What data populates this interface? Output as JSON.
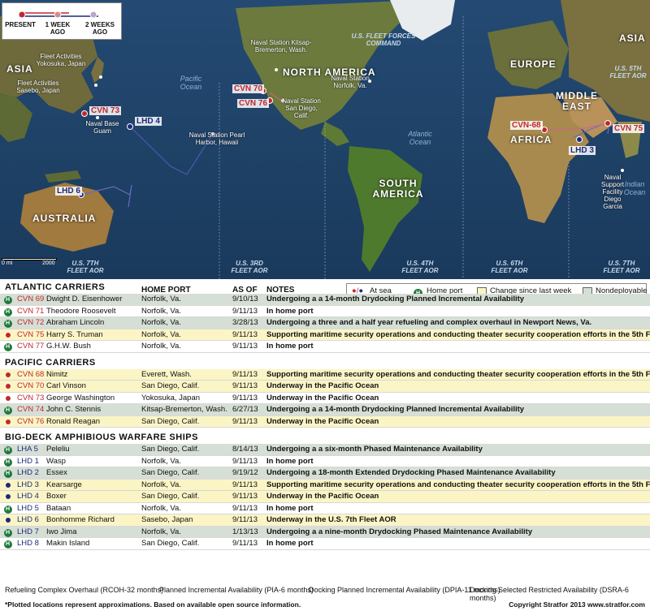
{
  "map": {
    "key": {
      "present": "PRESENT",
      "week_ago": "1 WEEK AGO",
      "two_weeks_ago": "2 WEEKS AGO"
    },
    "continents": [
      "ASIA",
      "NORTH AMERICA",
      "EUROPE",
      "MIDDLE EAST",
      "AFRICA",
      "SOUTH AMERICA",
      "AUSTRALIA",
      "ASIA"
    ],
    "oceans": [
      "Pacific Ocean",
      "Atlantic Ocean",
      "Indian Ocean"
    ],
    "fleets": [
      "U.S. FLEET FORCES COMMAND",
      "U.S. 5TH FLEET AOR",
      "U.S. 7TH FLEET AOR",
      "U.S. 3RD FLEET AOR",
      "U.S. 4TH FLEET AOR",
      "U.S. 6TH FLEET AOR",
      "U.S. 7TH FLEET AOR"
    ],
    "bases": [
      "Fleet Activities Yokosuka, Japan",
      "Fleet Activities Sasebo, Japan",
      "Naval Base Guam",
      "Naval Station Pearl Harbor, Hawaii",
      "Naval Station Kitsap-Bremerton, Wash.",
      "Naval Station San Diego, Calif.",
      "Naval Station Norfolk, Va.",
      "Naval Support Facility Diego Garcia"
    ],
    "ships": [
      "CVN 73",
      "LHD 4",
      "CVN 70",
      "CVN 76",
      "LHD 6",
      "CVN-68",
      "CVN 75",
      "LHD 3"
    ],
    "scale": {
      "zero": "0 mi",
      "max": "2000"
    }
  },
  "legend": {
    "at_sea": "At sea",
    "home_port": "Home port",
    "change": "Change since last week",
    "nondeployable": "Nondeployable"
  },
  "headers": {
    "home_port": "HOME PORT",
    "as_of": "AS OF",
    "notes": "NOTES"
  },
  "sections": [
    {
      "title": "ATLANTIC CARRIERS",
      "rows": [
        {
          "status": "home",
          "hull": "CVN 69",
          "name": "Dwight D. Eisenhower",
          "port": "Norfolk, Va.",
          "date": "9/10/13",
          "note": "Undergoing a a 14-month Drydocking Planned Incremental Availability",
          "shade": "nd"
        },
        {
          "status": "home",
          "hull": "CVN 71",
          "name": "Theodore Roosevelt",
          "port": "Norfolk, Va.",
          "date": "9/11/13",
          "note": "In home port",
          "shade": ""
        },
        {
          "status": "home",
          "hull": "CVN 72",
          "name": "Abraham Lincoln",
          "port": "Norfolk, Va.",
          "date": "3/28/13",
          "note": "Undergoing a three and a half year refueling and complex overhaul in Newport News, Va.",
          "shade": "nd"
        },
        {
          "status": "sea",
          "hull": "CVN 75",
          "name": "Harry S. Truman",
          "port": "Norfolk, Va.",
          "date": "9/11/13",
          "note": "Supporting maritime security operations and conducting theater security cooperation efforts in the 5th Fleet AOR",
          "shade": "hl"
        },
        {
          "status": "home",
          "hull": "CVN 77",
          "name": "G.H.W. Bush",
          "port": "Norfolk, Va.",
          "date": "9/11/13",
          "note": "In home port",
          "shade": ""
        }
      ]
    },
    {
      "title": "PACIFIC CARRIERS",
      "rows": [
        {
          "status": "sea",
          "hull": "CVN 68",
          "name": "Nimitz",
          "port": "Everett, Wash.",
          "date": "9/11/13",
          "note": "Supporting maritime security operations and conducting theater security cooperation efforts in the 5th Fleet AOR",
          "shade": "hl"
        },
        {
          "status": "sea",
          "hull": "CVN 70",
          "name": "Carl Vinson",
          "port": "San Diego, Calif.",
          "date": "9/11/13",
          "note": "Underway in the Pacific Ocean",
          "shade": "hl"
        },
        {
          "status": "sea",
          "hull": "CVN 73",
          "name": "George Washington",
          "port": "Yokosuka, Japan",
          "date": "9/11/13",
          "note": "Underway in the Pacific Ocean",
          "shade": ""
        },
        {
          "status": "home",
          "hull": "CVN 74",
          "name": "John C. Stennis",
          "port": "Kitsap-Bremerton, Wash.",
          "date": "6/27/13",
          "note": "Undergoing a a 14-month Drydocking Planned Incremental Availability",
          "shade": "nd"
        },
        {
          "status": "sea",
          "hull": "CVN 76",
          "name": "Ronald Reagan",
          "port": "San Diego, Calif.",
          "date": "9/11/13",
          "note": "Underway in the Pacific Ocean",
          "shade": "hl"
        }
      ]
    },
    {
      "title": "BIG-DECK AMPHIBIOUS WARFARE SHIPS",
      "rows": [
        {
          "status": "home",
          "hull": "LHA 5",
          "name": "Peleliu",
          "port": "San Diego, Calif.",
          "date": "8/14/13",
          "note": "Undergoing a a six-month Phased Maintenance Availability",
          "shade": "nd"
        },
        {
          "status": "home",
          "hull": "LHD 1",
          "name": "Wasp",
          "port": "Norfolk, Va.",
          "date": "9/11/13",
          "note": "In home port",
          "shade": ""
        },
        {
          "status": "home",
          "hull": "LHD 2",
          "name": "Essex",
          "port": "San Diego, Calif.",
          "date": "9/19/12",
          "note": "Undergoing a 18-month Extended Drydocking Phased Maintenance Availability",
          "shade": "nd"
        },
        {
          "status": "seab",
          "hull": "LHD 3",
          "name": "Kearsarge",
          "port": "Norfolk, Va.",
          "date": "9/11/13",
          "note": "Supporting maritime security operations and conducting theater security cooperation efforts in the 5th Fleet AOR",
          "shade": "hl"
        },
        {
          "status": "seab",
          "hull": "LHD 4",
          "name": "Boxer",
          "port": "San Diego, Calif.",
          "date": "9/11/13",
          "note": "Underway in the Pacific Ocean",
          "shade": "hl"
        },
        {
          "status": "home",
          "hull": "LHD 5",
          "name": "Bataan",
          "port": "Norfolk, Va.",
          "date": "9/11/13",
          "note": "In home port",
          "shade": ""
        },
        {
          "status": "seab",
          "hull": "LHD 6",
          "name": "Bonhomme Richard",
          "port": "Sasebo, Japan",
          "date": "9/11/13",
          "note": "Underway in the U.S. 7th Fleet AOR",
          "shade": "hl"
        },
        {
          "status": "home",
          "hull": "LHD 7",
          "name": "Iwo Jima",
          "port": "Norfolk, Va.",
          "date": "1/13/13",
          "note": "Undergoing a a nine-month Drydocking Phased Maintenance Availability",
          "shade": "nd"
        },
        {
          "status": "home",
          "hull": "LHD 8",
          "name": "Makin Island",
          "port": "San Diego, Calif.",
          "date": "9/11/13",
          "note": "In home port",
          "shade": ""
        }
      ]
    }
  ],
  "footnotes": {
    "defs": [
      "Refueling Complex Overhaul (RCOH-32 months)",
      "Planned Incremental Availability (PIA-6 months)",
      "Docking Planned Incremental Availability (DPIA-11 months)",
      "Docking Selected Restricted Availability (DSRA-6 months)"
    ],
    "note": "*Plotted locations represent approximations. Based on available open source information.",
    "copyright": "Copyright Stratfor 2013   www.stratfor.com"
  },
  "colors": {
    "carrier_red": "#c0282e",
    "amphib_blue": "#1c2a7a",
    "home_green": "#1f7a3a",
    "change_yellow": "#fbf5c6",
    "nondeployable_gray": "#d6dfd5"
  }
}
